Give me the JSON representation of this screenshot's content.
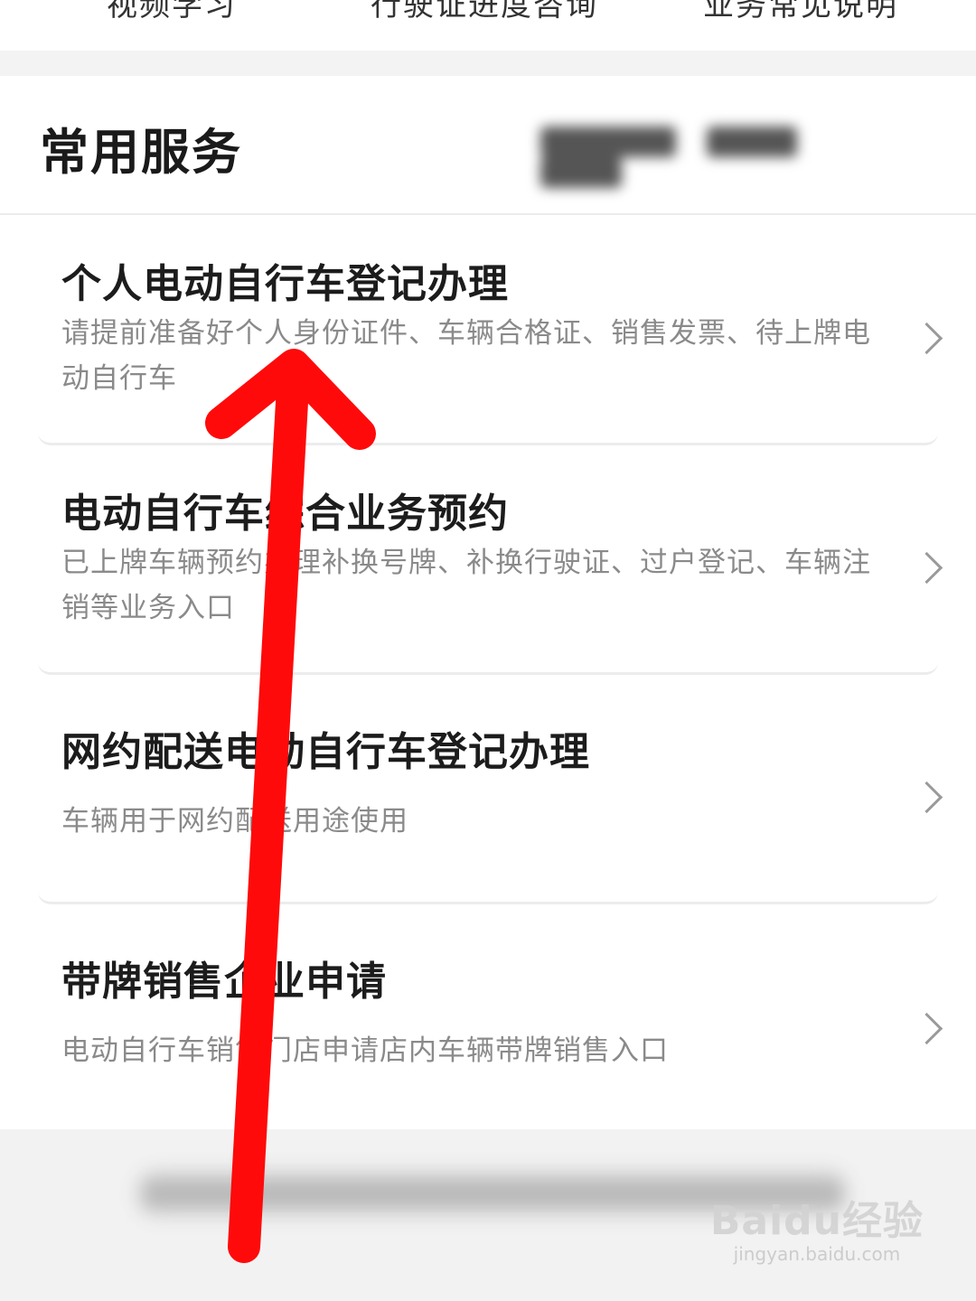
{
  "top_tabs": [
    "视频学习",
    "行驶证进度咨询",
    "业务常见说明"
  ],
  "section": {
    "title": "常用服务"
  },
  "services": [
    {
      "title": "个人电动自行车登记办理",
      "desc": "请提前准备好个人身份证件、车辆合格证、销售发票、待上牌电动自行车"
    },
    {
      "title": "电动自行车综合业务预约",
      "desc": "已上牌车辆预约办理补换号牌、补换行驶证、过户登记、车辆注销等业务入口"
    },
    {
      "title": "网约配送电动自行车登记办理",
      "desc": "车辆用于网约配送用途使用"
    },
    {
      "title": "带牌销售企业申请",
      "desc": "电动自行车销售门店申请店内车辆带牌销售入口"
    }
  ],
  "watermark": {
    "main": "Baidu经验",
    "sub": "jingyan.baidu.com"
  },
  "icons": {
    "chevron": "chevron-right-icon",
    "overlay": "red-arrow-up-icon"
  },
  "colors": {
    "arrow": "#ff0a0a",
    "title_text": "#1c1c1c",
    "desc_text": "#8a8a8a"
  }
}
